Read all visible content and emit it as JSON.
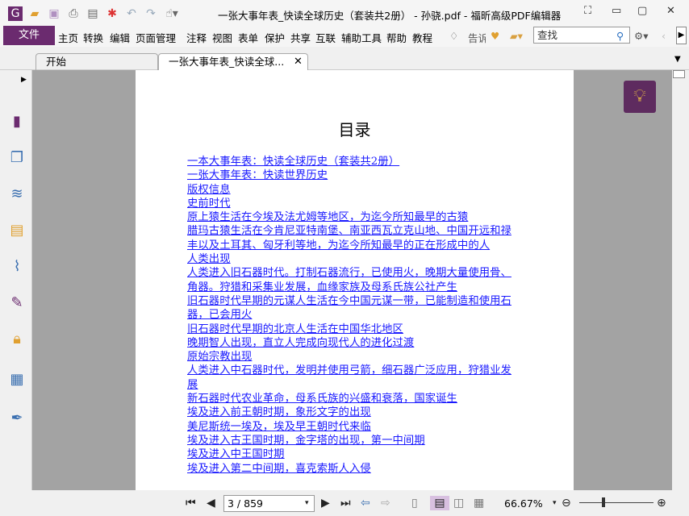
{
  "window": {
    "title": "一张大事年表_快读全球历史（套装共2册） - 孙骁.pdf - 福昕高级PDF编辑器"
  },
  "quick_access": [
    "app-logo-icon",
    "open-icon",
    "save-icon",
    "print-icon",
    "properties-icon",
    "new-icon",
    "undo-icon",
    "redo-icon",
    "hand-tool-icon"
  ],
  "menu": {
    "file": "文件",
    "items": [
      "主页",
      "转换",
      "编辑",
      "页面管理",
      "注释",
      "视图",
      "表单",
      "保护",
      "共享",
      "互联",
      "辅助工具",
      "帮助",
      "教程"
    ],
    "tell": "告诉"
  },
  "search": {
    "placeholder": "查找"
  },
  "tabs": [
    {
      "label": "开始"
    },
    {
      "label": "一张大事年表_快读全球..."
    }
  ],
  "sidebar": [
    "page-icon",
    "pages-icon",
    "layers-icon",
    "comments-icon",
    "attachment-icon",
    "signature-icon",
    "lock-icon",
    "form-icon",
    "certify-icon"
  ],
  "document": {
    "title": "目录",
    "toc": [
      "一本大事年表：快读全球历史（套装共2册）",
      "一张大事年表：快读世界历史",
      "版权信息",
      "史前时代",
      "原上猿生活在今埃及法尤姆等地区，为迄今所知最早的古猿",
      "腊玛古猿生活在今肯尼亚特南堡、南亚西瓦立克山地、中国开远和禄丰以及土耳其、匈牙利等地，为迄今所知最早的正在形成中的人",
      "人类出现",
      "人类进入旧石器时代。打制石器流行，已使用火，晚期大量使用骨、角器。狩猎和采集业发展，血缘家族及母系氏族公社产生",
      "旧石器时代早期的元谋人生活在今中国元谋一带，已能制造和使用石器，已会用火",
      "旧石器时代早期的北京人生活在中国华北地区",
      "晚期智人出现，直立人完成向现代人的进化过渡",
      "原始宗教出现",
      "人类进入中石器时代，发明并使用弓箭，细石器广泛应用，狩猎业发展",
      "新石器时代农业革命，母系氏族的兴盛和衰落，国家诞生",
      "埃及进入前王朝时期，象形文字的出现",
      "美尼斯统一埃及，埃及早王朝时代来临",
      "埃及进入古王国时期，金字塔的出现，第一中间期",
      "埃及进入中王国时期",
      "埃及进入第二中间期，喜克索斯人入侵"
    ]
  },
  "status": {
    "page": "3 / 859",
    "zoom": "66.67%",
    "zoom_level_percent": 66.67
  },
  "colors": {
    "accent": "#6b2b6f",
    "link": "#1a1aff"
  }
}
